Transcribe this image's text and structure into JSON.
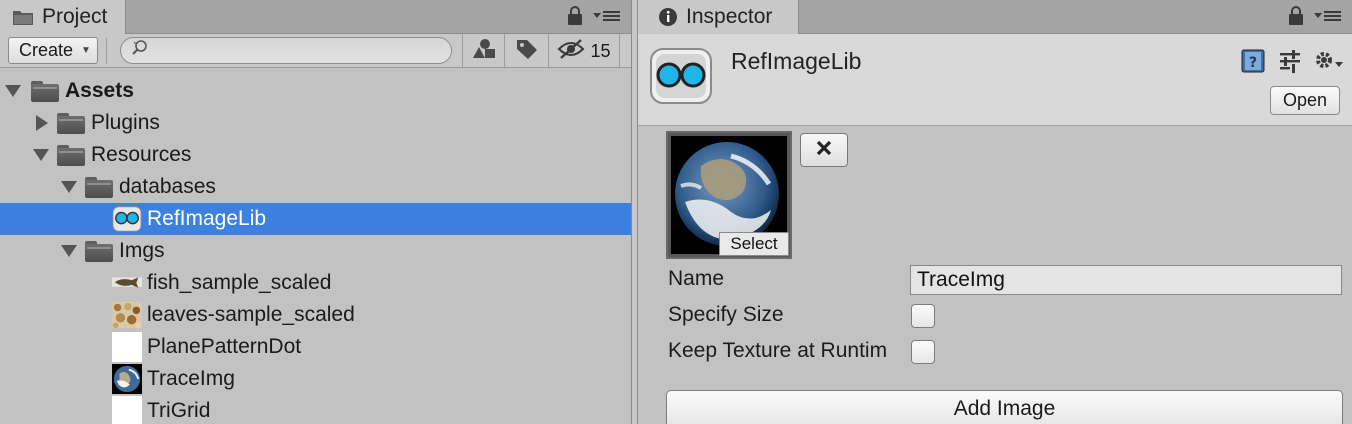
{
  "project": {
    "tab_label": "Project",
    "tab_icon": "folder-icon",
    "toolbar": {
      "create_label": "Create",
      "search_value": "",
      "search_placeholder": "",
      "hidden_packages_count": "15"
    },
    "tree": [
      {
        "label": "Assets",
        "icon": "folder-icon",
        "arrow": "expanded",
        "bold": true,
        "selected": false
      },
      {
        "label": "Plugins",
        "icon": "folder-icon",
        "arrow": "collapsed",
        "bold": false,
        "selected": false
      },
      {
        "label": "Resources",
        "icon": "folder-icon",
        "arrow": "expanded",
        "bold": false,
        "selected": false
      },
      {
        "label": "databases",
        "icon": "folder-icon",
        "arrow": "expanded",
        "bold": false,
        "selected": false
      },
      {
        "label": "RefImageLib",
        "icon": "reference-image-library-icon",
        "arrow": "none",
        "bold": false,
        "selected": true
      },
      {
        "label": "Imgs",
        "icon": "folder-icon",
        "arrow": "expanded",
        "bold": false,
        "selected": false
      },
      {
        "label": "fish_sample_scaled",
        "icon": "fish-thumbnail",
        "arrow": "none",
        "bold": false,
        "selected": false
      },
      {
        "label": "leaves-sample_scaled",
        "icon": "leaves-thumbnail",
        "arrow": "none",
        "bold": false,
        "selected": false
      },
      {
        "label": "PlanePatternDot",
        "icon": "white-texture-thumbnail",
        "arrow": "none",
        "bold": false,
        "selected": false
      },
      {
        "label": "TraceImg",
        "icon": "earth-thumbnail",
        "arrow": "none",
        "bold": false,
        "selected": false
      },
      {
        "label": "TriGrid",
        "icon": "white-texture-thumbnail",
        "arrow": "none",
        "bold": false,
        "selected": false
      }
    ]
  },
  "inspector": {
    "tab_label": "Inspector",
    "tab_icon": "info-icon",
    "asset_title": "RefImageLib",
    "open_label": "Open",
    "select_label": "Select",
    "remove_label": "×",
    "fields": {
      "name_label": "Name",
      "name_value": "TraceImg",
      "specify_size_label": "Specify Size",
      "specify_size_checked": false,
      "keep_texture_label": "Keep Texture at Runtim",
      "keep_texture_checked": false
    },
    "add_image_label": "Add Image"
  },
  "colors": {
    "selection": "#3d80df",
    "panel_bg": "#c2c2c2",
    "tab_bg": "#a4a4a4",
    "icon_cyan": "#1fb5e8"
  }
}
